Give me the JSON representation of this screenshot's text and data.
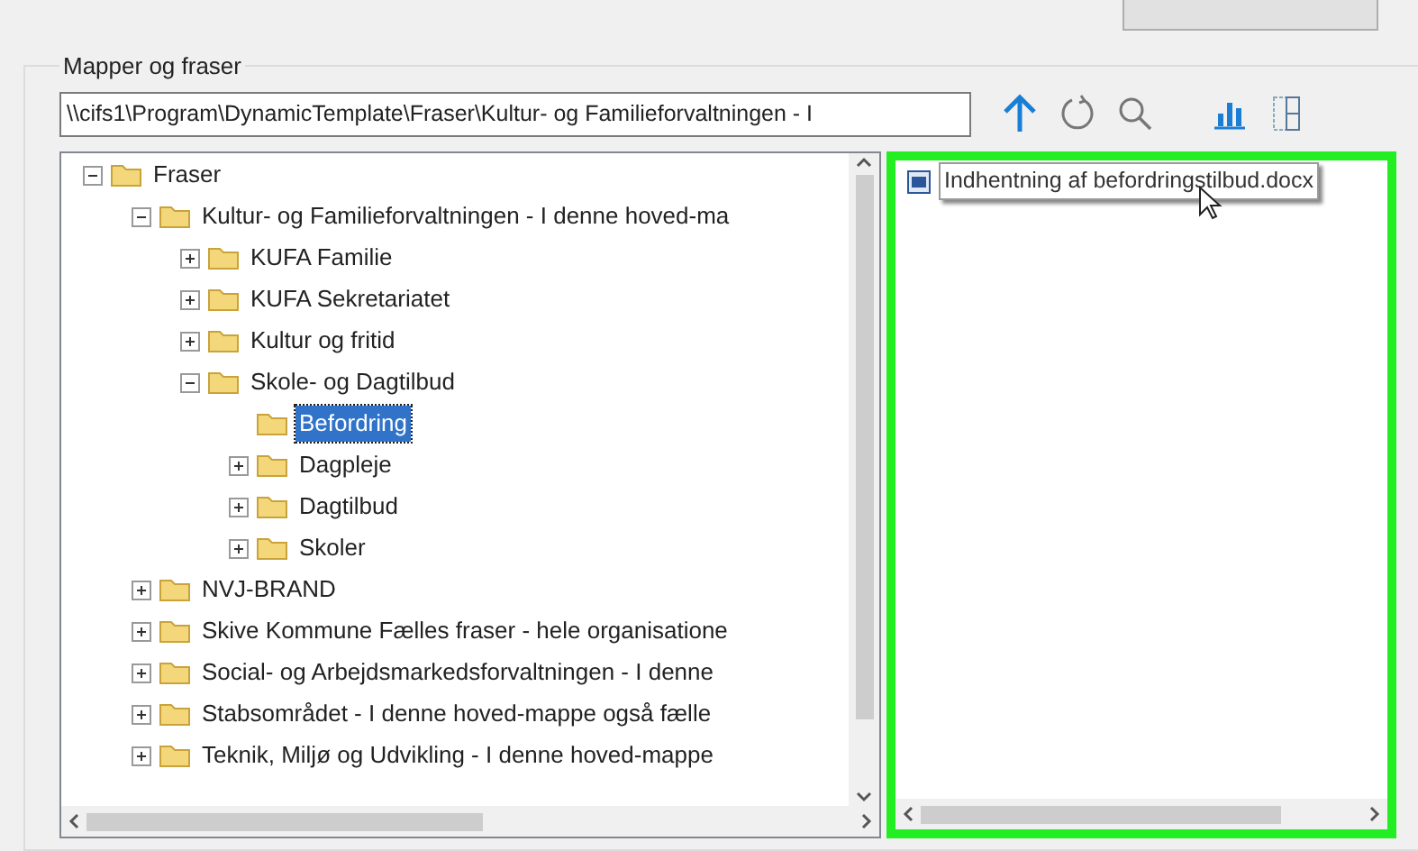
{
  "group": {
    "title": "Mapper og fraser"
  },
  "path_field": {
    "value": "\\\\cifs1\\Program\\DynamicTemplate\\Fraser\\Kultur- og Familieforvaltningen - I"
  },
  "tree": [
    {
      "label": "Fraser",
      "expanded": true,
      "selected": false,
      "children": [
        {
          "label": "Kultur- og Familieforvaltningen - I denne hoved-ma",
          "expanded": true,
          "selected": false,
          "children": [
            {
              "label": "KUFA Familie",
              "expanded": false,
              "selected": false
            },
            {
              "label": "KUFA Sekretariatet",
              "expanded": false,
              "selected": false
            },
            {
              "label": "Kultur og fritid",
              "expanded": false,
              "selected": false
            },
            {
              "label": "Skole- og Dagtilbud",
              "expanded": true,
              "selected": false,
              "children": [
                {
                  "label": "Befordring",
                  "selected": true
                },
                {
                  "label": "Dagpleje",
                  "expanded": false,
                  "selected": false
                },
                {
                  "label": "Dagtilbud",
                  "expanded": false,
                  "selected": false
                },
                {
                  "label": "Skoler",
                  "expanded": false,
                  "selected": false
                }
              ]
            }
          ]
        },
        {
          "label": "NVJ-BRAND",
          "expanded": false,
          "selected": false
        },
        {
          "label": "Skive Kommune Fælles fraser - hele organisatione",
          "expanded": false,
          "selected": false
        },
        {
          "label": "Social- og Arbejdsmarkedsforvaltningen - I denne",
          "expanded": false,
          "selected": false
        },
        {
          "label": "Stabsområdet - I denne hoved-mappe  også fælle",
          "expanded": false,
          "selected": false
        },
        {
          "label": "Teknik, Miljø og Udvikling - I denne hoved-mappe",
          "expanded": false,
          "selected": false
        }
      ]
    }
  ],
  "files": [
    {
      "name": "Indhentning af befordringstilbud.docx"
    }
  ]
}
